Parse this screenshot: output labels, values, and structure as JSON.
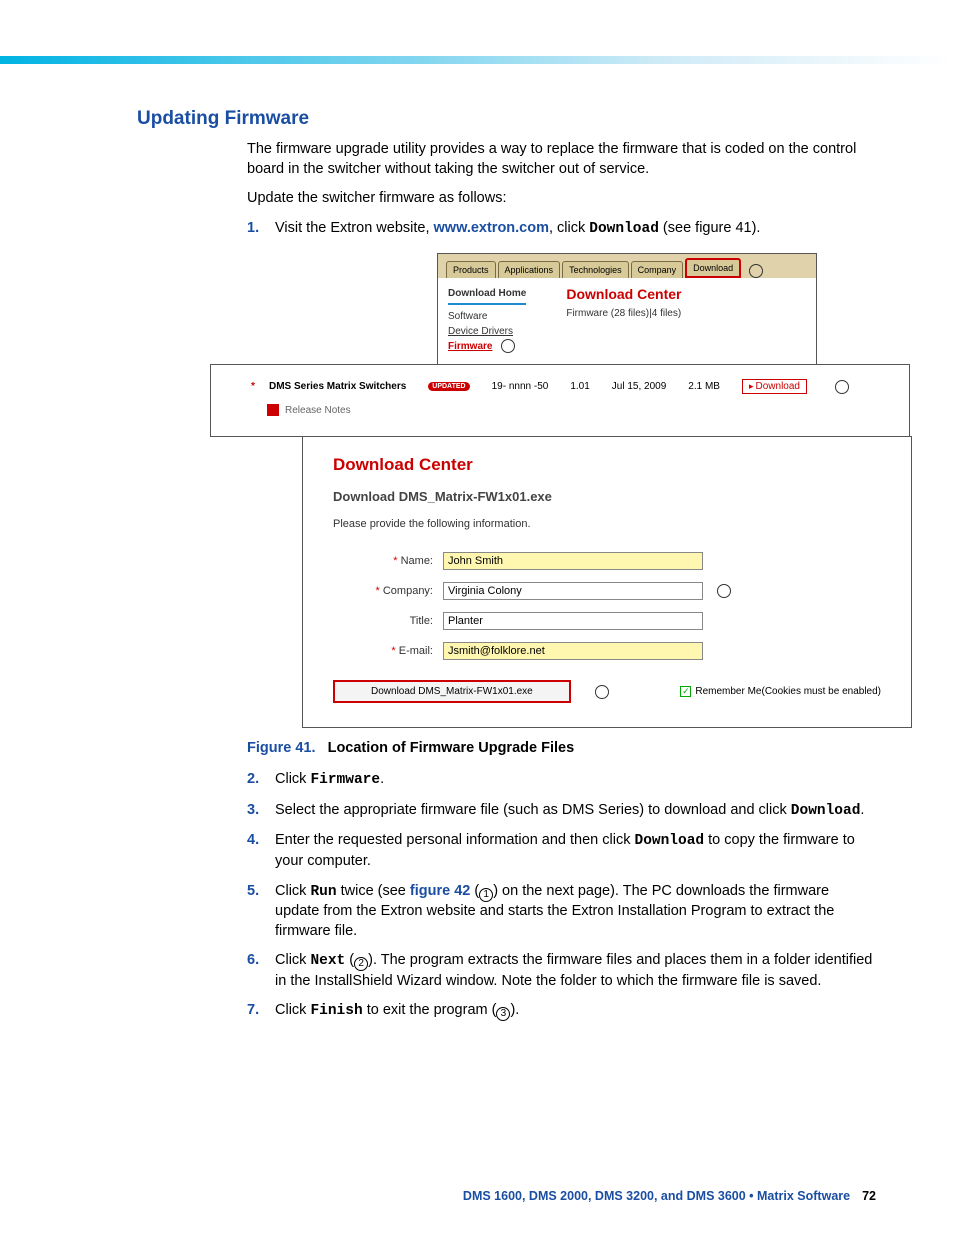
{
  "heading": "Updating Firmware",
  "intro1": "The firmware upgrade utility provides a way to replace the firmware that is coded on the control board in the switcher without taking the switcher out of service.",
  "intro2": "Update the switcher firmware as follows:",
  "steps": {
    "s1_pre": "Visit the Extron website, ",
    "s1_link": "www.extron.com",
    "s1_mid": ", click ",
    "s1_mono": "Download",
    "s1_post": " (see figure 41).",
    "s2_pre": "Click ",
    "s2_mono": "Firmware",
    "s2_post": ".",
    "s3_pre": "Select the appropriate firmware file (such as DMS Series) to download and click ",
    "s3_mono": "Download",
    "s3_post": ".",
    "s4_pre": "Enter the requested personal information and then click ",
    "s4_mono": "Download",
    "s4_post": " to copy the firmware to your computer.",
    "s5_pre": "Click ",
    "s5_mono": "Run",
    "s5_mid": " twice (see ",
    "s5_link": "figure 42",
    "s5_mid2": " (",
    "s5_circ": "1",
    "s5_post": ") on the next page). The PC downloads the firmware update from the Extron website and starts the Extron Installation Program to extract the firmware file.",
    "s6_pre": "Click ",
    "s6_mono": "Next",
    "s6_mid": " (",
    "s6_circ": "2",
    "s6_post": "). The program extracts the firmware files and places them in a folder identified in the InstallShield Wizard window. Note the folder to which the firmware file is saved.",
    "s7_pre": "Click ",
    "s7_mono": "Finish",
    "s7_mid": " to exit the program (",
    "s7_circ": "3",
    "s7_post": ")."
  },
  "nums": {
    "n1": "1.",
    "n2": "2.",
    "n3": "3.",
    "n4": "4.",
    "n5": "5.",
    "n6": "6.",
    "n7": "7."
  },
  "fig": {
    "tabs": {
      "products": "Products",
      "applications": "Applications",
      "technologies": "Technologies",
      "company": "Company",
      "download": "Download"
    },
    "navleft": {
      "home": "Download Home",
      "software": "Software",
      "drivers": "Device Drivers",
      "firmware": "Firmware"
    },
    "navright": {
      "title": "Download Center",
      "count": "Firmware (28 files)|4 files)"
    },
    "row": {
      "name": "DMS Series Matrix Switchers",
      "badge": "UPDATED",
      "part": "19- nnnn -50",
      "ver": "1.01",
      "date": "Jul 15, 2009",
      "size": "2.1 MB",
      "dl": "Download"
    },
    "relnotes": "Release Notes",
    "form": {
      "title": "Download Center",
      "file": "Download DMS_Matrix-FW1x01.exe",
      "instr": "Please provide the following information.",
      "labels": {
        "name": "Name:",
        "company": "Company:",
        "title": "Title:",
        "email": "E-mail:"
      },
      "star": "*",
      "values": {
        "name": "John Smith",
        "company": "Virginia Colony",
        "title": "Planter",
        "email": "Jsmith@folklore.net"
      },
      "button": "Download DMS_Matrix-FW1x01.exe",
      "remember": "Remember Me(Cookies must be enabled)"
    }
  },
  "caption": {
    "label": "Figure 41.",
    "title": "Location of Firmware Upgrade Files"
  },
  "footer": {
    "title": "DMS 1600, DMS 2000, DMS 3200, and DMS 3600 • Matrix Software",
    "page": "72"
  }
}
